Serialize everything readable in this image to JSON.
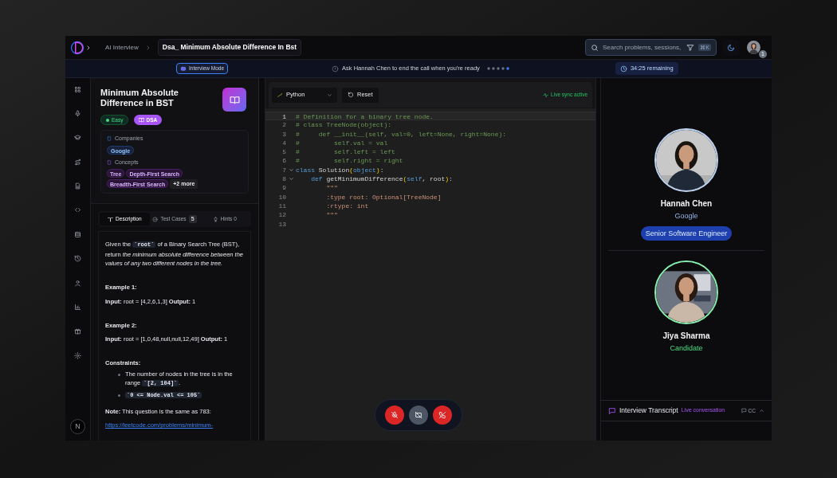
{
  "header": {
    "breadcrumb": [
      "AI Interview",
      "Dsa_ Minimum Absolute Difference In Bst"
    ],
    "search": {
      "placeholder": "Search problems, sessions,"
    },
    "shortcut": "⌘K",
    "notification_count": "1"
  },
  "banner": {
    "mode": "Interview Mode",
    "message": "Ask Hannah Chen to end the call when you're ready",
    "timer": "34:25 remaining"
  },
  "problem": {
    "title": "Minimum Absolute Difference in BST",
    "difficulty": "Easy",
    "category": "DSA",
    "companies_label": "Companies",
    "companies": [
      "Google"
    ],
    "concepts_label": "Concepts",
    "concepts": [
      "Tree",
      "Depth-First Search",
      "Breadth-First Search"
    ],
    "more": "+2 more"
  },
  "tabs": [
    {
      "label": "Description",
      "selected": true
    },
    {
      "label": "Test Cases",
      "count": "5",
      "selected": false
    },
    {
      "label": "Hints 0",
      "selected": false
    }
  ],
  "description": [
    {
      "kind": "paragraph",
      "parts": [
        {
          "text": "Given the "
        },
        {
          "code": "`root`"
        },
        {
          "text": " of a Binary Search Tree (BST), return *the minimum absolute difference between the values of any two different nodes in the tree.*"
        }
      ]
    },
    {
      "kind": "heading",
      "text": "Example 1:"
    },
    {
      "kind": "paragraph",
      "parts": [
        {
          "text": "**Input:** root = [4,2,6,1,3] **Output:** 1"
        }
      ]
    },
    {
      "kind": "heading",
      "text": "Example 2:"
    },
    {
      "kind": "paragraph",
      "parts": [
        {
          "text": "**Input:** root = [1,0,48,null,null,12,49] **Output:** 1"
        }
      ]
    },
    {
      "kind": "heading",
      "text": "Constraints:"
    },
    {
      "kind": "list",
      "items": [
        [
          {
            "text": "The number of nodes in the tree is in the range "
          },
          {
            "code": "`[2, 104]`"
          },
          {
            "text": "."
          }
        ],
        [
          {
            "code": "`0 <= Node.val <= 105`"
          }
        ]
      ]
    },
    {
      "kind": "paragraph",
      "parts": [
        {
          "text": "**Note:** This question is the same as 783:"
        }
      ]
    },
    {
      "kind": "link",
      "text": "https://leetcode.com/problems/minimum-"
    }
  ],
  "editor": {
    "language": "Python",
    "reset": "Reset",
    "sync": "Live sync active",
    "lines": [
      {
        "number": "1",
        "active": true,
        "fold": false,
        "tokens": [
          {
            "kind": "comment",
            "text": "# Definition for a binary tree node."
          }
        ]
      },
      {
        "number": "2",
        "active": false,
        "fold": false,
        "tokens": [
          {
            "kind": "comment",
            "text": "# class TreeNode(object):"
          }
        ]
      },
      {
        "number": "3",
        "active": false,
        "fold": false,
        "tokens": [
          {
            "kind": "comment",
            "text": "#     def __init__(self, val=0, left=None, right=None):"
          }
        ]
      },
      {
        "number": "4",
        "active": false,
        "fold": false,
        "tokens": [
          {
            "kind": "comment",
            "text": "#         self.val = val"
          }
        ]
      },
      {
        "number": "5",
        "active": false,
        "fold": false,
        "tokens": [
          {
            "kind": "comment",
            "text": "#         self.left = left"
          }
        ]
      },
      {
        "number": "6",
        "active": false,
        "fold": false,
        "tokens": [
          {
            "kind": "comment",
            "text": "#         self.right = right"
          }
        ]
      },
      {
        "number": "7",
        "active": false,
        "fold": true,
        "tokens": [
          {
            "kind": "keyword",
            "text": "class"
          },
          {
            "kind": "plain",
            "text": " Solution"
          },
          {
            "kind": "paren",
            "text": "("
          },
          {
            "kind": "keyword",
            "text": "object"
          },
          {
            "kind": "paren",
            "text": ")"
          },
          {
            "kind": "plain",
            "text": ":"
          }
        ]
      },
      {
        "number": "8",
        "active": false,
        "fold": true,
        "tokens": [
          {
            "kind": "keyword",
            "text": "    def"
          },
          {
            "kind": "plain",
            "text": " getMinimumDifference"
          },
          {
            "kind": "paren",
            "text": "("
          },
          {
            "kind": "keyword",
            "text": "self"
          },
          {
            "kind": "plain",
            "text": ", root"
          },
          {
            "kind": "paren",
            "text": ")"
          },
          {
            "kind": "plain",
            "text": ":"
          }
        ]
      },
      {
        "number": "9",
        "active": false,
        "fold": false,
        "tokens": [
          {
            "kind": "string",
            "text": "        \"\"\""
          }
        ]
      },
      {
        "number": "10",
        "active": false,
        "fold": false,
        "tokens": [
          {
            "kind": "string",
            "text": "        :type root: Optional[TreeNode]"
          }
        ]
      },
      {
        "number": "11",
        "active": false,
        "fold": false,
        "tokens": [
          {
            "kind": "string",
            "text": "        :rtype: int"
          }
        ]
      },
      {
        "number": "12",
        "active": false,
        "fold": false,
        "tokens": [
          {
            "kind": "string",
            "text": "        \"\"\""
          }
        ]
      },
      {
        "number": "13",
        "active": false,
        "fold": false
      }
    ]
  },
  "interviewer": {
    "name": "Hannah Chen",
    "company": "Google",
    "role": "Senior Software Engineer"
  },
  "candidate": {
    "name": "Jiya Sharma",
    "role": "Candidate"
  },
  "transcript": {
    "title": "Interview Transcript",
    "status": "Live conversation",
    "captions": "CC"
  },
  "user_initial": "N"
}
